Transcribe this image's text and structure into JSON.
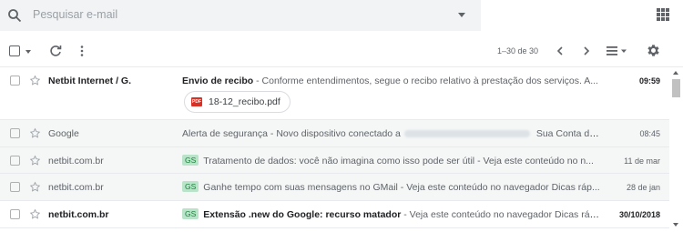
{
  "search": {
    "placeholder": "Pesquisar e-mail"
  },
  "toolbar": {
    "pager": "1–30 de 30"
  },
  "icons": {
    "search": "search-icon",
    "caret": "caret-down-icon",
    "apps": "apps-grid-icon",
    "refresh": "refresh-icon",
    "more": "more-vert-icon",
    "prev": "chevron-left-icon",
    "next": "chevron-right-icon",
    "density": "density-icon",
    "gear": "gear-icon",
    "star": "star-icon"
  },
  "colors": {
    "label_bg": "#b9e4c9",
    "label_fg": "#188038",
    "pdf": "#d93025",
    "read_row_bg": "#f5f7f7"
  },
  "emails": [
    {
      "sender": "Netbit Internet / G.",
      "subject": "Envio de recibo",
      "snippet": " - Conforme entendimentos, segue o recibo relativo à prestação dos serviços. A...",
      "date": "09:59",
      "unread": true,
      "attachment": "18-12_recibo.pdf"
    },
    {
      "sender": "Google",
      "subject": "Alerta de segurança",
      "snippet": " - Novo dispositivo conectado a",
      "snippet_after": " Sua Conta do...",
      "date": "08:45",
      "unread": false
    },
    {
      "sender": "netbit.com.br",
      "label": "GS",
      "subject": "Tratamento de dados: você não imagina como isso pode ser útil",
      "snippet": " - Veja este conteúdo no n...",
      "date": "11 de mar",
      "unread": false
    },
    {
      "sender": "netbit.com.br",
      "label": "GS",
      "subject": "Ganhe tempo com suas mensagens no GMail",
      "snippet": " - Veja este conteúdo no navegador Dicas ráp...",
      "date": "28 de jan",
      "unread": false
    },
    {
      "sender": "netbit.com.br",
      "label": "GS",
      "subject": "Extensão .new do Google: recurso matador",
      "snippet": " - Veja este conteúdo no navegador Dicas rápid...",
      "date": "30/10/2018",
      "unread": true
    }
  ]
}
